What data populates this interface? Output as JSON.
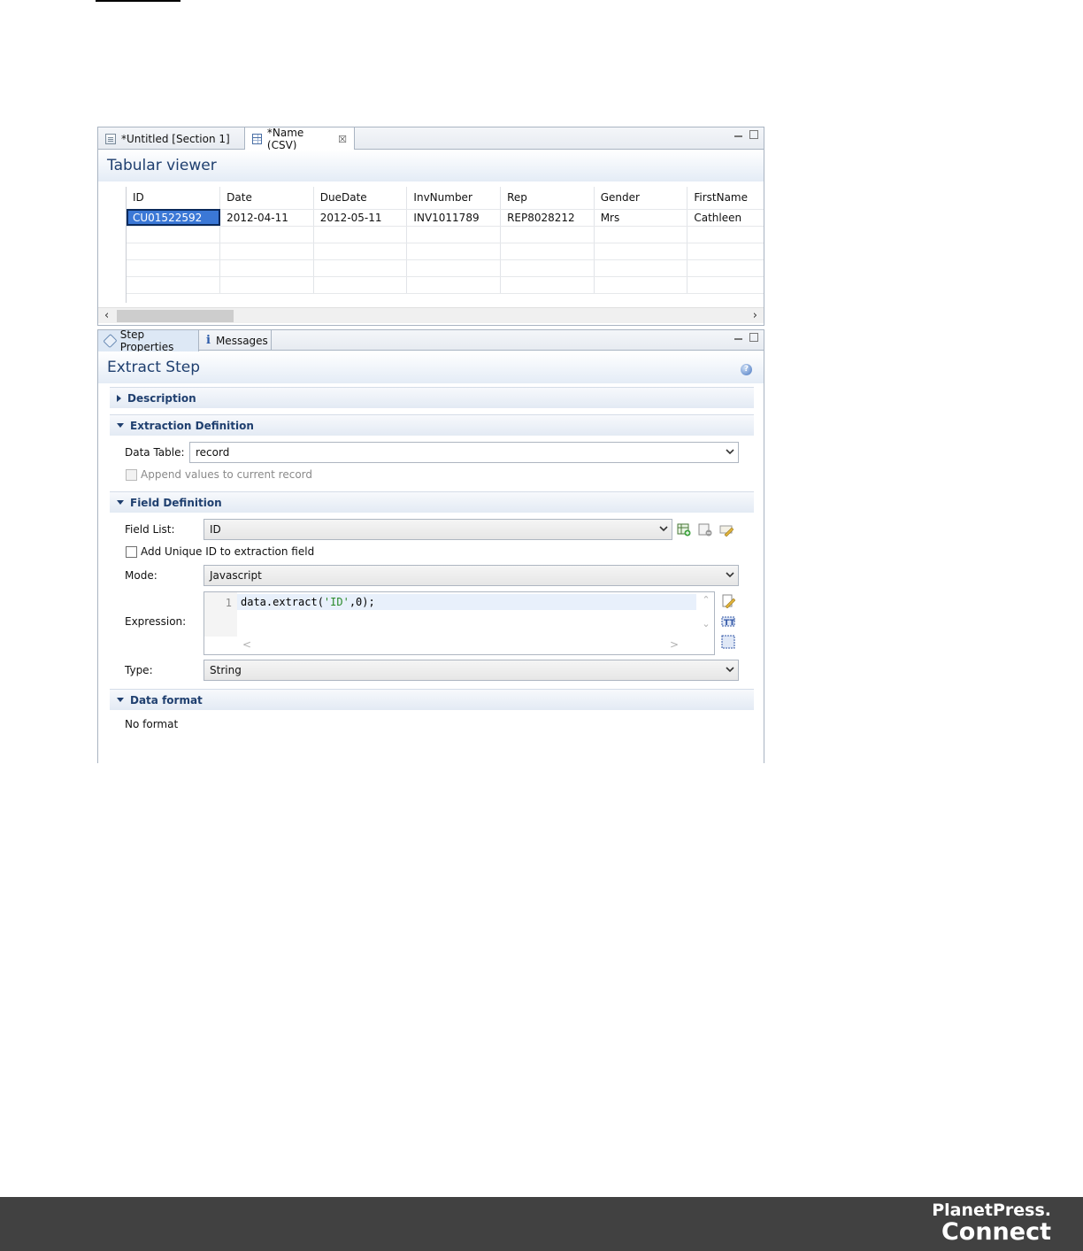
{
  "editor": {
    "tabs": [
      {
        "label": "*Untitled [Section 1]",
        "icon": "document-icon"
      },
      {
        "label": "*Name (CSV)",
        "icon": "table-icon",
        "closable": true
      }
    ],
    "close_glyph": "☒",
    "title": "Tabular viewer",
    "columns": [
      "ID",
      "Date",
      "DueDate",
      "InvNumber",
      "Rep",
      "Gender",
      "FirstName"
    ],
    "rows": [
      [
        "CU01522592",
        "2012-04-11",
        "2012-05-11",
        "INV1011789",
        "REP8028212",
        "Mrs",
        "Cathleen"
      ]
    ],
    "scroll_left": "‹",
    "scroll_right": "›"
  },
  "properties": {
    "tabs": [
      {
        "label": "Step Properties",
        "icon": "tag-icon"
      },
      {
        "label": "Messages",
        "icon": "info-icon"
      }
    ],
    "info_glyph": "i",
    "help_glyph": "?",
    "title": "Extract Step",
    "sections": {
      "description": "Description",
      "extraction": "Extraction Definition",
      "field": "Field Definition",
      "format": "Data format"
    },
    "data_table_label": "Data Table:",
    "data_table_value": "record",
    "append_label": "Append values to current record",
    "field_list_label": "Field List:",
    "field_list_value": "ID",
    "unique_id_label": "Add Unique ID to extraction field",
    "mode_label": "Mode:",
    "mode_value": "Javascript",
    "expression_label": "Expression:",
    "expression_line_no": "1",
    "expression_code_pre": "data.extract(",
    "expression_code_str": "'ID'",
    "expression_code_post": ",0);",
    "type_label": "Type:",
    "type_value": "String",
    "format_value": "No format",
    "scroll_glyphs": {
      "up": "⌃",
      "down": "⌄",
      "left": "<",
      "right": ">"
    }
  },
  "footer": {
    "brand_line1": "PlanetPress.",
    "brand_line2": "Connect",
    "background": "#414141"
  }
}
